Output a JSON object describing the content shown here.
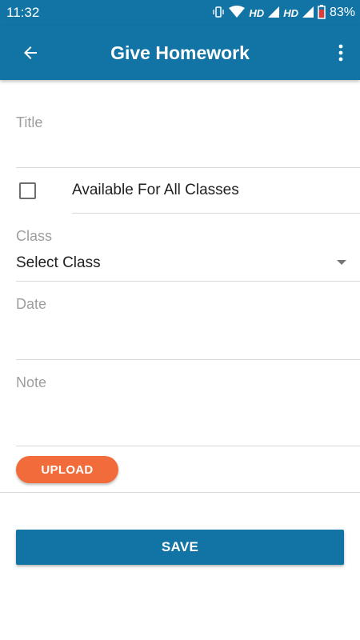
{
  "status_bar": {
    "time": "11:32",
    "hd_label_1": "HD",
    "hd_label_2": "HD",
    "battery": "83%"
  },
  "toolbar": {
    "title": "Give Homework",
    "back_icon": "arrow-back-icon",
    "menu_icon": "more-vert-icon"
  },
  "form": {
    "title_label": "Title",
    "title_value": "",
    "all_classes_label": "Available For All Classes",
    "all_classes_checked": false,
    "class_label": "Class",
    "class_value": "Select Class",
    "date_label": "Date",
    "date_value": "",
    "note_label": "Note",
    "note_value": ""
  },
  "buttons": {
    "upload": "UPLOAD",
    "save": "SAVE"
  },
  "colors": {
    "primary": "#1274a5",
    "accent": "#f26b3a"
  }
}
